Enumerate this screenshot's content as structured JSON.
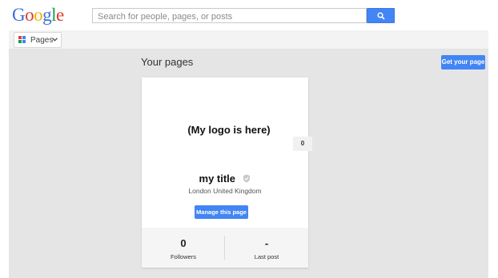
{
  "header": {
    "logo_letters": [
      "G",
      "o",
      "o",
      "g",
      "l",
      "e"
    ],
    "search_placeholder": "Search for people, pages, or posts",
    "search_button_icon": "search-icon"
  },
  "subbar": {
    "pages_label": "Pages",
    "pages_icon": "pages-grid-icon",
    "chevron_icon": "chevron-down-icon"
  },
  "main": {
    "heading": "Your pages",
    "get_page_label": "Get your page"
  },
  "card": {
    "logo_text": "(My logo is here)",
    "count_badge": "0",
    "title": "my title",
    "verified_icon": "verified-shield-icon",
    "location": "London United Kingdom",
    "manage_label": "Manage this page",
    "stats": [
      {
        "value": "0",
        "label": "Followers"
      },
      {
        "value": "-",
        "label": "Last post"
      }
    ]
  },
  "colors": {
    "accent_blue": "#4285f4",
    "grey_background": "#e5e5e5"
  }
}
